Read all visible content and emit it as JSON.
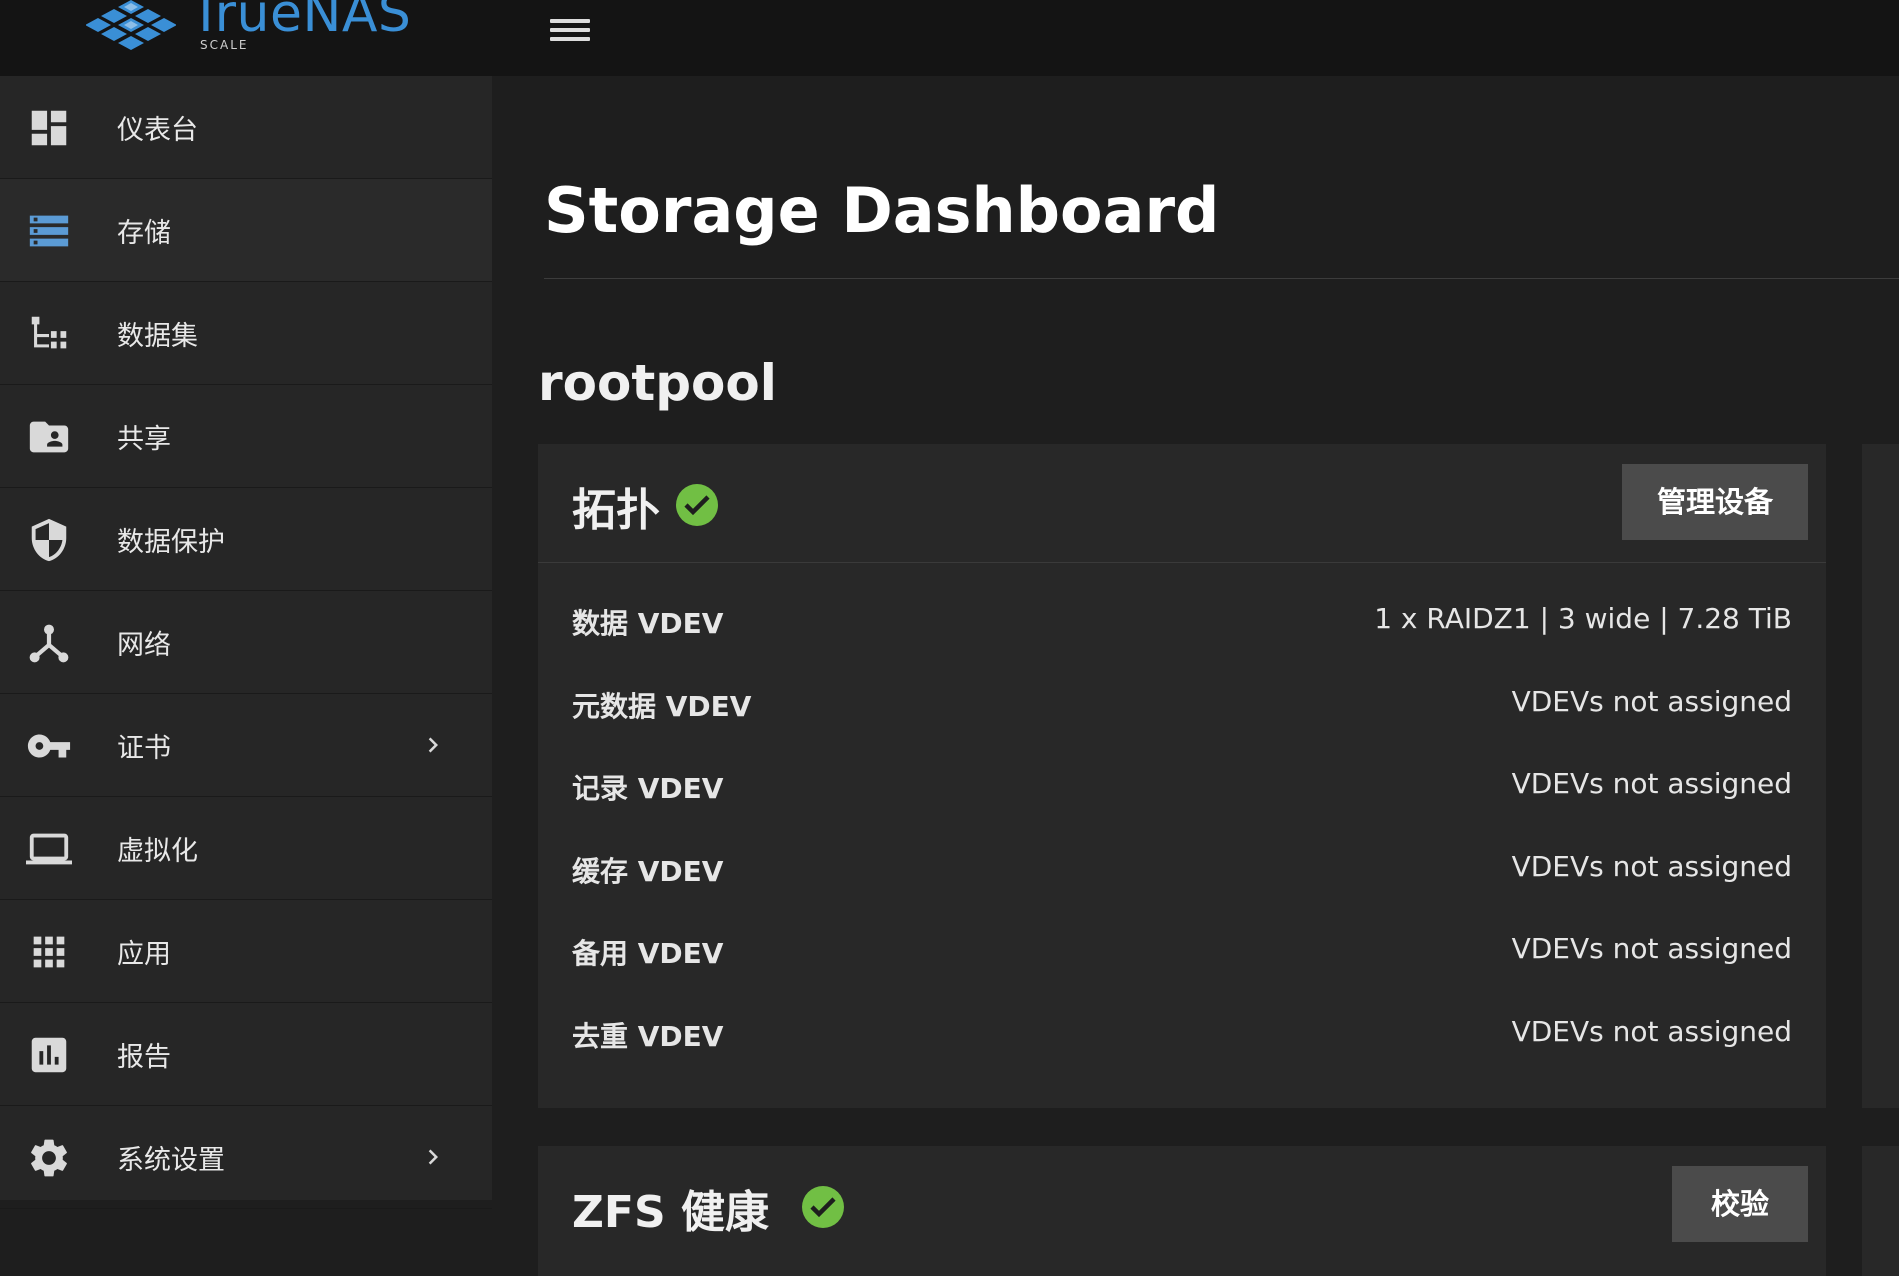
{
  "app": {
    "logo_text": "TrueNAS",
    "logo_sub": "SCALE"
  },
  "sidebar": {
    "items": [
      {
        "label": "仪表台",
        "icon": "dashboard-icon"
      },
      {
        "label": "存储",
        "icon": "storage-icon"
      },
      {
        "label": "数据集",
        "icon": "datasets-icon"
      },
      {
        "label": "共享",
        "icon": "shares-folder-icon"
      },
      {
        "label": "数据保护",
        "icon": "shield-icon"
      },
      {
        "label": "网络",
        "icon": "network-icon"
      },
      {
        "label": "证书",
        "icon": "key-icon"
      },
      {
        "label": "虚拟化",
        "icon": "laptop-icon"
      },
      {
        "label": "应用",
        "icon": "apps-grid-icon"
      },
      {
        "label": "报告",
        "icon": "bar-chart-icon"
      },
      {
        "label": "系统设置",
        "icon": "gear-icon"
      }
    ]
  },
  "main": {
    "title": "Storage Dashboard",
    "pool_name": "rootpool",
    "topology": {
      "title": "拓扑",
      "manage_button": "管理设备",
      "rows": [
        {
          "key": "数据 VDEV",
          "value": "1 x RAIDZ1 | 3 wide | 7.28 TiB"
        },
        {
          "key": "元数据 VDEV",
          "value": "VDEVs not assigned"
        },
        {
          "key": "记录 VDEV",
          "value": "VDEVs not assigned"
        },
        {
          "key": "缓存 VDEV",
          "value": "VDEVs not assigned"
        },
        {
          "key": "备用 VDEV",
          "value": "VDEVs not assigned"
        },
        {
          "key": "去重 VDEV",
          "value": "VDEVs not assigned"
        }
      ]
    },
    "zfs_health": {
      "title": "ZFS 健康",
      "button": "校验"
    }
  },
  "colors": {
    "accent": "#3a8fd6",
    "ok": "#71bf44",
    "storage_icon": "#5b9bd5"
  }
}
